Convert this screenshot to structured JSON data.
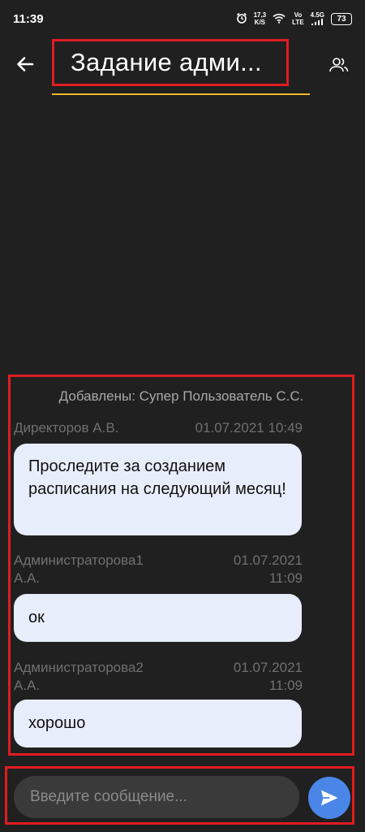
{
  "status_bar": {
    "time": "11:39",
    "speed_value": "17,3",
    "speed_unit": "K/S",
    "volte_top": "Vo",
    "volte_bottom": "LTE",
    "network": "4.5G",
    "battery": "73"
  },
  "header": {
    "title": "Задание адми..."
  },
  "messages": {
    "system_note": "Добавлены: Супер Пользователь С.С.",
    "items": [
      {
        "author": "Директоров А.В.",
        "time": "01.07.2021 10:49",
        "text": "Проследите за созданием расписания на следующий месяц!"
      },
      {
        "author_line1": "Администраторова1",
        "author_line2": "А.А.",
        "date": "01.07.2021",
        "time": "11:09",
        "text": "ок"
      },
      {
        "author_line1": "Администраторова2",
        "author_line2": "А.А.",
        "date": "01.07.2021",
        "time": "11:09",
        "text": "хорошо"
      }
    ]
  },
  "composer": {
    "placeholder": "Введите сообщение...",
    "value": ""
  },
  "colors": {
    "background": "#202020",
    "highlight_border": "#e11b22",
    "title_underline": "#f2b92c",
    "bubble": "#e8edfb",
    "send_button": "#4a86e8"
  },
  "icons": {
    "back": "arrow-left-icon",
    "members": "group-icon",
    "send": "send-icon",
    "alarm": "alarm-icon",
    "wifi": "wifi-icon",
    "signal": "signal-icon"
  }
}
